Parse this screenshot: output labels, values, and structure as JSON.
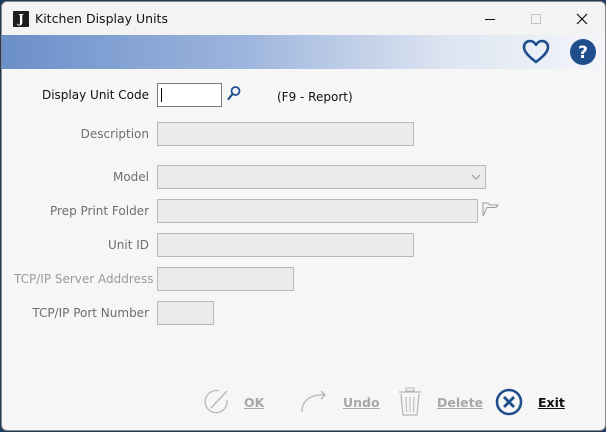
{
  "window": {
    "title": "Kitchen Display Units",
    "app_icon_letter": "J"
  },
  "banner": {
    "icons": [
      "heart-icon",
      "help-icon"
    ],
    "help_glyph": "?"
  },
  "form": {
    "display_unit_code": {
      "label": "Display Unit Code",
      "value": ""
    },
    "report_hint": "(F9 - Report)",
    "description": {
      "label": "Description",
      "value": ""
    },
    "model": {
      "label": "Model",
      "value": ""
    },
    "prep_print_folder": {
      "label": "Prep Print Folder",
      "value": ""
    },
    "unit_id": {
      "label": "Unit ID",
      "value": ""
    },
    "tcpip_server_address": {
      "label": "TCP/IP Server Adddress",
      "value": ""
    },
    "tcpip_port_number": {
      "label": "TCP/IP Port Number",
      "value": ""
    }
  },
  "buttons": {
    "ok": "OK",
    "undo": "Undo",
    "delete": "Delete",
    "exit": "Exit"
  },
  "colors": {
    "accent": "#1f4e8c",
    "banner_start": "#6b8fca"
  }
}
